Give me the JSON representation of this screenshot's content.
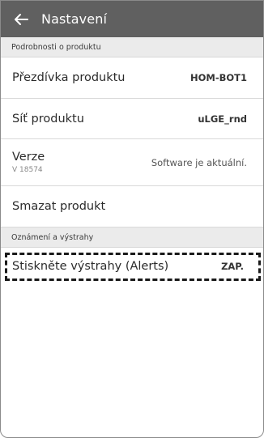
{
  "header": {
    "title": "Nastavení",
    "back_icon": "arrow-left-icon"
  },
  "sections": {
    "product_details": "Podrobnosti o produktu",
    "notifications": "Oznámení a výstrahy"
  },
  "rows": {
    "nickname": {
      "label": "Přezdívka produktu",
      "value": "HOM-BOT1"
    },
    "network": {
      "label": "Síť produktu",
      "value": "uLGE_rnd"
    },
    "version": {
      "label": "Verze",
      "sub": "V 18574",
      "value": "Software je aktuální."
    },
    "delete": {
      "label": "Smazat produkt"
    },
    "alerts": {
      "label": "Stiskněte výstrahy (Alerts)",
      "value": "ZAP."
    }
  },
  "colors": {
    "header_bg": "#606060",
    "section_bg": "#ebebeb"
  }
}
